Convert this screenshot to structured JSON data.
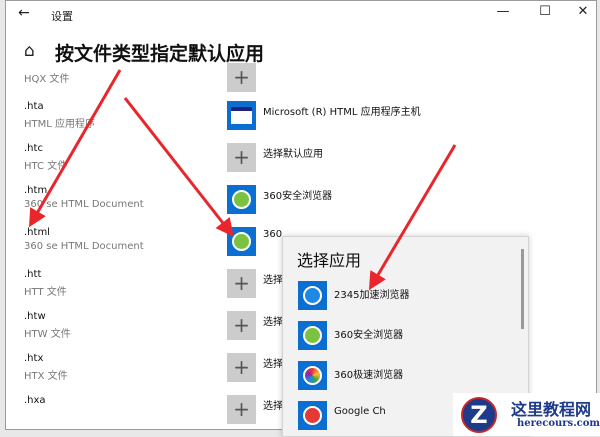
{
  "window": {
    "title": "设置",
    "back": "←",
    "minimize": "—",
    "maximize": "☐",
    "close": "✕"
  },
  "page": {
    "home_icon": "⌂",
    "heading": "按文件类型指定默认应用"
  },
  "rows": [
    {
      "ext": "",
      "desc": "HQX 文件",
      "app": "",
      "icon": "plus"
    },
    {
      "ext": ".hta",
      "desc": "HTML 应用程序",
      "app": "Microsoft (R) HTML 应用程序主机",
      "icon": "window"
    },
    {
      "ext": ".htc",
      "desc": "HTC 文件",
      "app": "选择默认应用",
      "icon": "plus"
    },
    {
      "ext": ".htm",
      "desc": "360 se HTML Document",
      "app": "360安全浏览器",
      "icon": "360se"
    },
    {
      "ext": ".html",
      "desc": "360 se HTML Document",
      "app": "360",
      "icon": "360se"
    },
    {
      "ext": ".htt",
      "desc": "HTT 文件",
      "app": "选择",
      "icon": "plus"
    },
    {
      "ext": ".htw",
      "desc": "HTW 文件",
      "app": "选择",
      "icon": "plus"
    },
    {
      "ext": ".htx",
      "desc": "HTX 文件",
      "app": "选择",
      "icon": "plus"
    },
    {
      "ext": ".hxa",
      "desc": "",
      "app": "选择",
      "icon": "plus"
    }
  ],
  "popup": {
    "title": "选择应用",
    "items": [
      {
        "label": "2345加速浏览器",
        "icon": "2345-icon"
      },
      {
        "label": "360安全浏览器",
        "icon": "360se-icon"
      },
      {
        "label": "360极速浏览器",
        "icon": "360chrome-icon"
      },
      {
        "label": "Google Ch",
        "icon": "chrome-icon"
      }
    ]
  },
  "watermark": {
    "title": "这里教程网",
    "url": "herecours.com"
  },
  "colors": {
    "accent": "#0a6fd0",
    "arrow": "#e8262b"
  }
}
